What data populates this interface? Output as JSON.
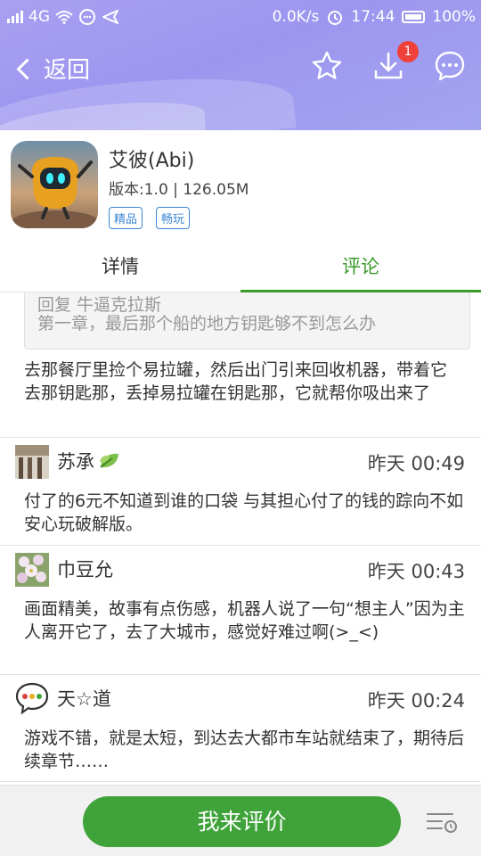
{
  "status_bar": {
    "network": "4G",
    "speed": "0.0K/s",
    "time": "17:44",
    "battery": "100%"
  },
  "nav": {
    "back_label": "返回",
    "download_badge": "1"
  },
  "app": {
    "title": "艾彼(Abi)",
    "version_line": "版本:1.0 | 126.05M",
    "tags": [
      "精品",
      "畅玩"
    ]
  },
  "tabs": [
    {
      "label": "详情"
    },
    {
      "label": "评论"
    }
  ],
  "colors": {
    "accent": "#3a9a2a",
    "header": "#a29cf0",
    "badge": "#f0403a",
    "tag": "#3b86d6"
  },
  "reply": {
    "quote_to": "回复 牛逼克拉斯",
    "quote_text": "第一章，最后那个船的地方钥匙够不到怎么办",
    "text": "去那餐厅里捡个易拉罐，然后出门引来回收机器，带着它去那钥匙那，丢掉易拉罐在钥匙那，它就帮你吸出来了"
  },
  "comments": [
    {
      "name": "苏承",
      "time": "昨天 00:49",
      "text": "付了的6元不知道到谁的口袋 与其担心付了的钱的踪向不如安心玩破解版。"
    },
    {
      "name": "巾豆允",
      "time": "昨天 00:43",
      "text": "画面精美，故事有点伤感，机器人说了一句“想主人”因为主人离开它了，去了大城市，感觉好难过啊(>_<)"
    },
    {
      "name": "天☆道",
      "time": "昨天 00:24",
      "text": "游戏不错，就是太短，到达去大都市车站就结束了，期待后续章节……"
    }
  ],
  "bottom": {
    "rate_button": "我来评价"
  }
}
